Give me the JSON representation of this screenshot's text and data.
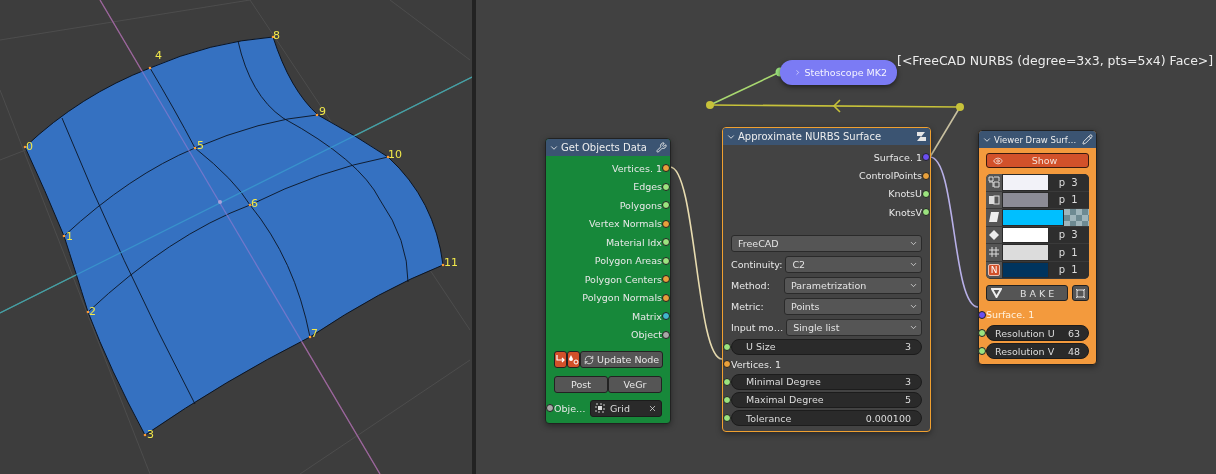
{
  "viewport": {
    "vertex_labels": [
      "0",
      "1",
      "2",
      "3",
      "4",
      "5",
      "6",
      "7",
      "8",
      "9",
      "10",
      "11"
    ]
  },
  "stethoscope": {
    "title": "Stethoscope MK2",
    "output": "[<FreeCAD NURBS (degree=3x3, pts=5x4) Face>]"
  },
  "get_objects": {
    "title": "Get Objects Data",
    "outputs": [
      {
        "label": "Vertices. 1",
        "color": "#e8a03b"
      },
      {
        "label": "Edges",
        "color": "#9be37f"
      },
      {
        "label": "Polygons",
        "color": "#9be37f"
      },
      {
        "label": "Vertex Normals",
        "color": "#e8a03b"
      },
      {
        "label": "Material Idx",
        "color": "#9be37f"
      },
      {
        "label": "Polygon Areas",
        "color": "#9be37f"
      },
      {
        "label": "Polygon Centers",
        "color": "#e8a03b"
      },
      {
        "label": "Polygon Normals",
        "color": "#e8a03b"
      },
      {
        "label": "Matrix",
        "color": "#3fb8cc"
      },
      {
        "label": "Object",
        "color": "#a8a8a8"
      }
    ],
    "update_button": "Update Node",
    "toggles": [
      "Post",
      "VeGr"
    ],
    "object_input": {
      "label": "Obje…",
      "value": "Grid",
      "color": "#a8a8a8"
    }
  },
  "nurbs": {
    "title": "Approximate NURBS Surface",
    "selected": true,
    "outputs": [
      {
        "label": "Surface. 1",
        "color": "#6a4ef0"
      },
      {
        "label": "ControlPoints",
        "color": "#e8a03b"
      },
      {
        "label": "KnotsU",
        "color": "#9be37f"
      },
      {
        "label": "KnotsV",
        "color": "#9be37f"
      }
    ],
    "implementation": "FreeCAD",
    "dropdowns": [
      {
        "label": "Continuity:",
        "value": "C2"
      },
      {
        "label": "Method:",
        "value": "Parametrization"
      },
      {
        "label": "Metric:",
        "value": "Points"
      },
      {
        "label": "Input mo…",
        "value": "Single list"
      }
    ],
    "inputs": [
      {
        "kind": "number",
        "label": "U Size",
        "value": "3",
        "color": "#9be37f"
      },
      {
        "kind": "socket",
        "label": "Vertices. 1",
        "color": "#e8a03b"
      },
      {
        "kind": "number",
        "label": "Minimal Degree",
        "value": "3",
        "color": "#9be37f"
      },
      {
        "kind": "number",
        "label": "Maximal Degree",
        "value": "5",
        "color": "#9be37f"
      },
      {
        "kind": "number",
        "label": "Tolerance",
        "value": "0.000100",
        "color": "#9be37f"
      }
    ]
  },
  "viewer": {
    "title": "Viewer Draw Surf…",
    "show": "Show",
    "rows": [
      {
        "kind": "verts",
        "color": "#f2f2f8",
        "value": "p 3"
      },
      {
        "kind": "edges",
        "color": "#8c8c96",
        "value": "p 1"
      },
      {
        "kind": "faces",
        "color": "#00bfff"
      },
      {
        "kind": "points",
        "color": "#ffffff",
        "value": "p 3"
      },
      {
        "kind": "grid",
        "color": "#dcdcdc",
        "value": "p 1"
      },
      {
        "kind": "normals",
        "badge": "N",
        "color": "#00345e",
        "value": "p 1"
      }
    ],
    "bake": "BAKE",
    "input": {
      "label": "Surface. 1",
      "color": "#6a4ef0"
    },
    "fields": [
      {
        "label": "Resolution U",
        "value": "63",
        "color": "#9be37f"
      },
      {
        "label": "Resolution V",
        "value": "48",
        "color": "#9be37f"
      }
    ]
  }
}
